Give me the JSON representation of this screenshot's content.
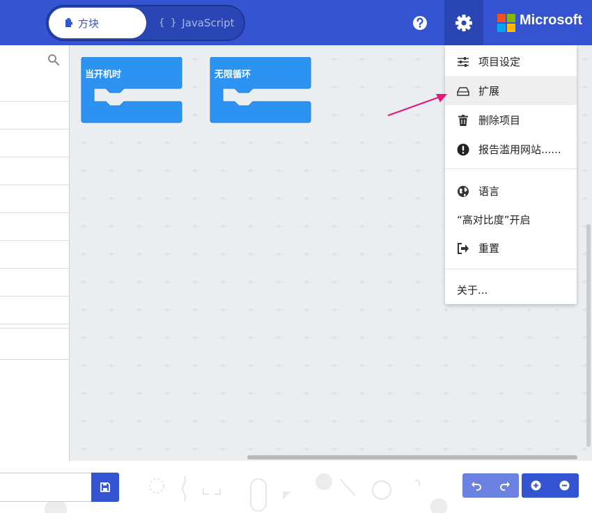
{
  "header": {
    "toggle": {
      "blocks_label": "方块",
      "js_brace": "{ }",
      "js_label": "JavaScript"
    },
    "brand": "Microsoft",
    "brand_colors": [
      "#f25022",
      "#7fba00",
      "#00a4ef",
      "#ffb900"
    ],
    "accent": "#3454d1"
  },
  "workspace": {
    "blocks": [
      {
        "label": "当开机时",
        "color": "#2c93f3"
      },
      {
        "label": "无限循环",
        "color": "#2c93f3"
      }
    ]
  },
  "settings_menu": {
    "items": [
      {
        "label": "项目设定",
        "icon": "sliders-icon"
      },
      {
        "label": "扩展",
        "icon": "drive-icon",
        "hovered": true
      },
      {
        "label": "删除项目",
        "icon": "trash-icon"
      },
      {
        "label": "报告滥用网站......",
        "icon": "exclamation-circle-icon"
      },
      {
        "label": "语言",
        "icon": "globe-icon"
      },
      {
        "label": "“高对比度”开启",
        "icon": ""
      },
      {
        "label": "重置",
        "icon": "sign-out-icon"
      },
      {
        "label": "关于...",
        "icon": ""
      }
    ]
  },
  "annotation": {
    "arrow_color": "#e8157a"
  },
  "bottom_bar": {
    "project_name_value": "",
    "project_name_placeholder": ""
  }
}
